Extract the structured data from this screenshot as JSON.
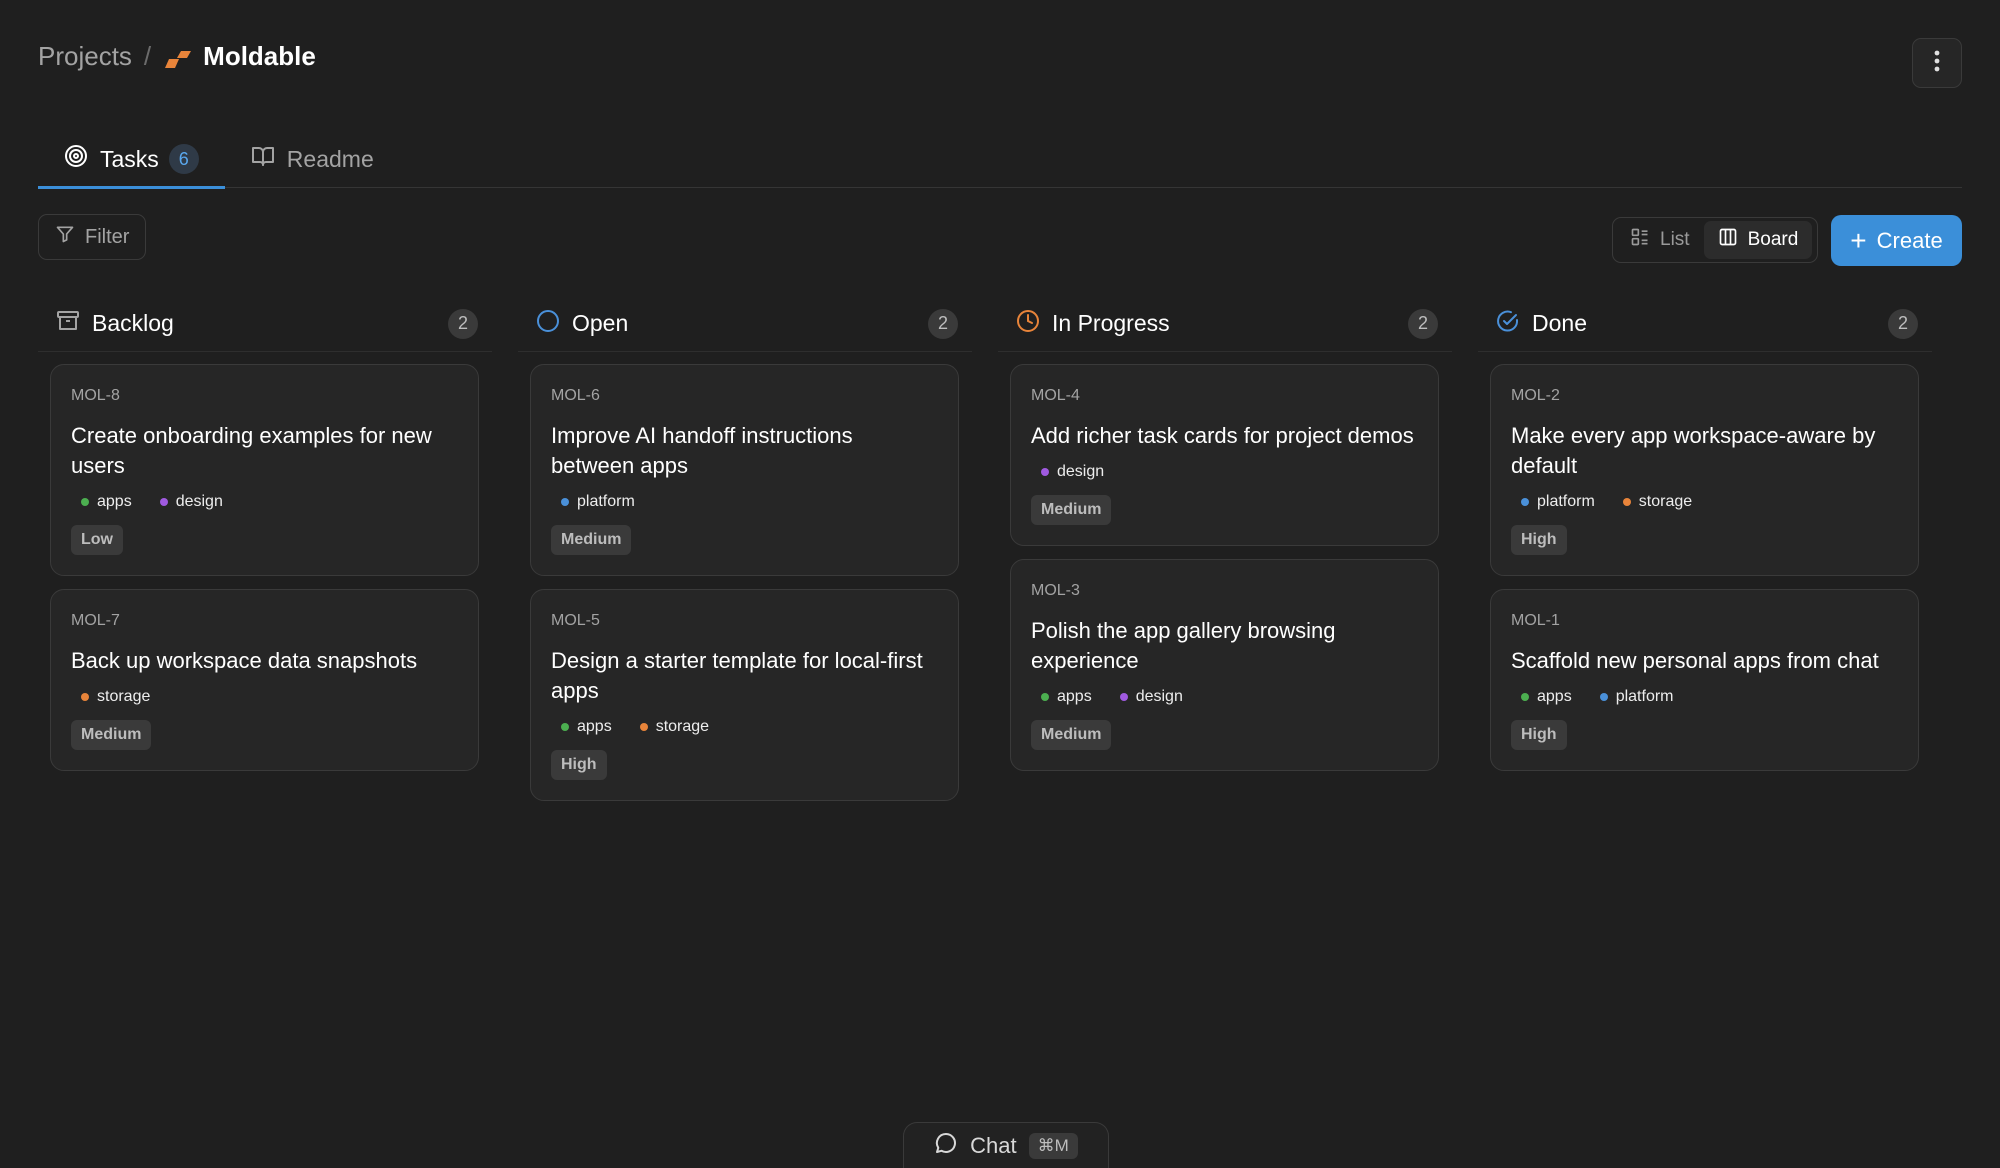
{
  "breadcrumb": {
    "root": "Projects",
    "separator": "/",
    "project": "Moldable"
  },
  "tabs": [
    {
      "label": "Tasks",
      "count": "6",
      "active": true
    },
    {
      "label": "Readme",
      "active": false
    }
  ],
  "toolbar": {
    "filter_label": "Filter",
    "view_list_label": "List",
    "view_board_label": "Board",
    "active_view": "Board",
    "create_label": "Create"
  },
  "colors": {
    "accent": "#3b8fd9",
    "label_apps": "#4caf50",
    "label_design": "#a05ae0",
    "label_platform": "#4a90d9",
    "label_storage": "#e8843a",
    "status_open": "#4a90d9",
    "status_in_progress": "#e8843a",
    "status_done": "#4a90d9"
  },
  "columns": [
    {
      "title": "Backlog",
      "count": "2",
      "icon": "archive-icon",
      "cards": [
        {
          "id": "MOL-8",
          "title": "Create onboarding examples for new users",
          "labels": [
            "apps",
            "design"
          ],
          "priority": "Low"
        },
        {
          "id": "MOL-7",
          "title": "Back up workspace data snapshots",
          "labels": [
            "storage"
          ],
          "priority": "Medium"
        }
      ]
    },
    {
      "title": "Open",
      "count": "2",
      "icon": "circle-icon",
      "cards": [
        {
          "id": "MOL-6",
          "title": "Improve AI handoff instructions between apps",
          "labels": [
            "platform"
          ],
          "priority": "Medium"
        },
        {
          "id": "MOL-5",
          "title": "Design a starter template for local-first apps",
          "labels": [
            "apps",
            "storage"
          ],
          "priority": "High"
        }
      ]
    },
    {
      "title": "In Progress",
      "count": "2",
      "icon": "clock-icon",
      "cards": [
        {
          "id": "MOL-4",
          "title": "Add richer task cards for project demos",
          "labels": [
            "design"
          ],
          "priority": "Medium"
        },
        {
          "id": "MOL-3",
          "title": "Polish the app gallery browsing experience",
          "labels": [
            "apps",
            "design"
          ],
          "priority": "Medium"
        }
      ]
    },
    {
      "title": "Done",
      "count": "2",
      "icon": "check-circle-icon",
      "cards": [
        {
          "id": "MOL-2",
          "title": "Make every app workspace-aware by default",
          "labels": [
            "platform",
            "storage"
          ],
          "priority": "High"
        },
        {
          "id": "MOL-1",
          "title": "Scaffold new personal apps from chat",
          "labels": [
            "apps",
            "platform"
          ],
          "priority": "High"
        }
      ]
    }
  ],
  "chat": {
    "label": "Chat",
    "shortcut": "⌘M"
  }
}
